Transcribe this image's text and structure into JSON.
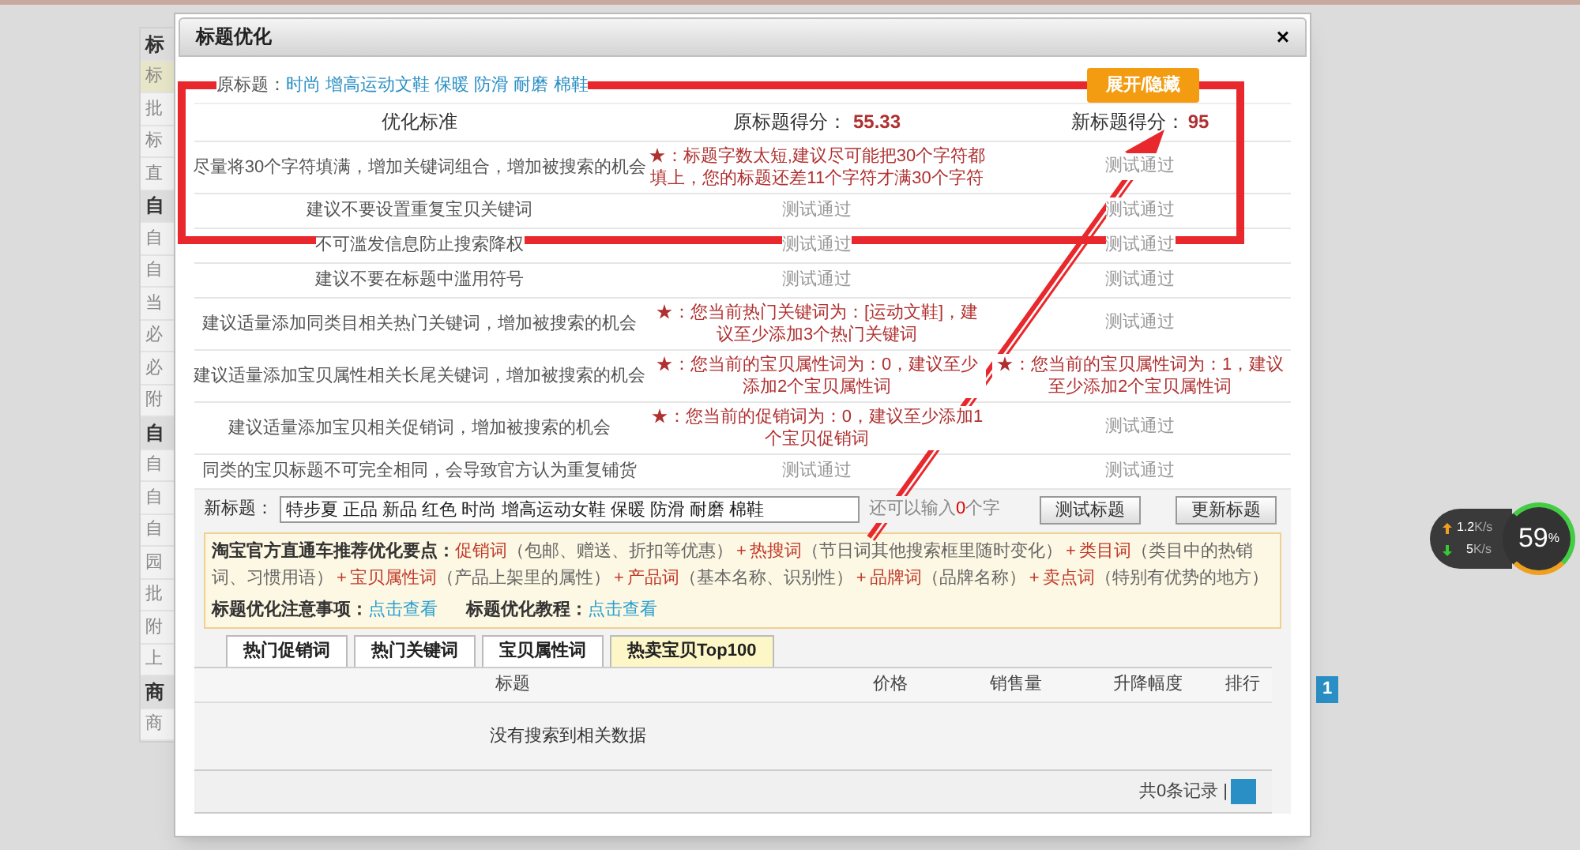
{
  "background_sidebar": {
    "items": [
      {
        "text": "标",
        "kind": "header"
      },
      {
        "text": "标",
        "kind": "item",
        "selected": true
      },
      {
        "text": "批",
        "kind": "item",
        "selected": false
      },
      {
        "text": "标",
        "kind": "item",
        "selected": false
      },
      {
        "text": "直",
        "kind": "item",
        "selected": false
      },
      {
        "text": "自",
        "kind": "header"
      },
      {
        "text": "自",
        "kind": "item",
        "selected": false
      },
      {
        "text": "自",
        "kind": "item",
        "selected": false
      },
      {
        "text": "当",
        "kind": "item",
        "selected": false
      },
      {
        "text": "必",
        "kind": "item",
        "selected": false
      },
      {
        "text": "必",
        "kind": "item",
        "selected": false
      },
      {
        "text": "附",
        "kind": "item",
        "selected": false
      },
      {
        "text": "自",
        "kind": "header"
      },
      {
        "text": "自",
        "kind": "item",
        "selected": false
      },
      {
        "text": "自",
        "kind": "item",
        "selected": false
      },
      {
        "text": "自",
        "kind": "item",
        "selected": false
      },
      {
        "text": "园",
        "kind": "item",
        "selected": false
      },
      {
        "text": "批",
        "kind": "item",
        "selected": false
      },
      {
        "text": "附",
        "kind": "item",
        "selected": false
      },
      {
        "text": "上",
        "kind": "item",
        "selected": false
      },
      {
        "text": "商",
        "kind": "header"
      },
      {
        "text": "商",
        "kind": "item",
        "selected": false
      }
    ]
  },
  "background_pager": {
    "page": "1"
  },
  "network_widget": {
    "upload": "1.2",
    "upload_unit": "K/s",
    "download": "5",
    "download_unit": "K/s",
    "percent": "59",
    "percent_sign": "%"
  },
  "dialog": {
    "title": "标题优化",
    "close": "×",
    "original_title": {
      "label": "原标题：",
      "value": "时尚 增高运动文鞋 保暖 防滑 耐磨 棉鞋"
    },
    "toggle_button": "展开/隐藏",
    "header": {
      "standard": "优化标准",
      "original_label": "原标题得分：",
      "original_score": "55.33",
      "new_label": "新标题得分：",
      "new_score": "95"
    },
    "rows": [
      {
        "standard": "尽量将30个字符填满，增加关键词组合，增加被搜索的机会",
        "original": {
          "kind": "warn",
          "text": "★：标题字数太短,建议尽可能把30个字符都填上，您的标题还差11个字符才满30个字符"
        },
        "new": {
          "kind": "pass",
          "text": "测试通过"
        }
      },
      {
        "standard": "建议不要设置重复宝贝关键词",
        "original": {
          "kind": "pass",
          "text": "测试通过"
        },
        "new": {
          "kind": "pass",
          "text": "测试通过"
        }
      },
      {
        "standard": "不可滥发信息防止搜索降权",
        "original": {
          "kind": "pass",
          "text": "测试通过"
        },
        "new": {
          "kind": "pass",
          "text": "测试通过"
        }
      },
      {
        "standard": "建议不要在标题中滥用符号",
        "original": {
          "kind": "pass",
          "text": "测试通过"
        },
        "new": {
          "kind": "pass",
          "text": "测试通过"
        }
      },
      {
        "standard": "建议适量添加同类目相关热门关键词，增加被搜索的机会",
        "original": {
          "kind": "warn",
          "text": "★：您当前热门关键词为：[运动文鞋]，建议至少添加3个热门关键词"
        },
        "new": {
          "kind": "pass",
          "text": "测试通过"
        }
      },
      {
        "standard": "建议适量添加宝贝属性相关长尾关键词，增加被搜索的机会",
        "original": {
          "kind": "warn",
          "text": "★：您当前的宝贝属性词为：0，建议至少添加2个宝贝属性词"
        },
        "new": {
          "kind": "warn",
          "text": "★：您当前的宝贝属性词为：1，建议至少添加2个宝贝属性词"
        }
      },
      {
        "standard": "建议适量添加宝贝相关促销词，增加被搜索的机会",
        "original": {
          "kind": "warn",
          "text": "★：您当前的促销词为：0，建议至少添加1个宝贝促销词"
        },
        "new": {
          "kind": "pass",
          "text": "测试通过"
        }
      },
      {
        "standard": "同类的宝贝标题不可完全相同，会导致官方认为重复铺货",
        "original": {
          "kind": "pass",
          "text": "测试通过"
        },
        "new": {
          "kind": "pass",
          "text": "测试通过"
        }
      }
    ],
    "new_title": {
      "label": "新标题：",
      "value": "特步夏 正品 新品 红色 时尚 增高运动女鞋 保暖 防滑 耐磨 棉鞋",
      "remain_before": "还可以输入",
      "remain_count": "0",
      "remain_after": "个字",
      "test_button": "测试标题",
      "update_button": "更新标题"
    },
    "tips": {
      "segments": [
        {
          "kind": "heading",
          "text": "淘宝官方直通车推荐优化要点："
        },
        {
          "kind": "term",
          "text": "促销词"
        },
        {
          "kind": "desc",
          "text": "（包邮、赠送、折扣等优惠）"
        },
        {
          "kind": "plus",
          "text": "+"
        },
        {
          "kind": "term",
          "text": "热搜词"
        },
        {
          "kind": "desc",
          "text": "（节日词其他搜索框里随时变化）"
        },
        {
          "kind": "plus",
          "text": "+"
        },
        {
          "kind": "term",
          "text": "类目词"
        },
        {
          "kind": "desc",
          "text": "（类目中的热销词、习惯用语）"
        },
        {
          "kind": "plus",
          "text": "+"
        },
        {
          "kind": "term",
          "text": "宝贝属性词"
        },
        {
          "kind": "desc",
          "text": "（产品上架里的属性）"
        },
        {
          "kind": "plus",
          "text": "+"
        },
        {
          "kind": "term",
          "text": "产品词"
        },
        {
          "kind": "desc",
          "text": "（基本名称、识别性）"
        },
        {
          "kind": "plus",
          "text": "+"
        },
        {
          "kind": "term",
          "text": "品牌词"
        },
        {
          "kind": "desc",
          "text": "（品牌名称）"
        },
        {
          "kind": "plus",
          "text": "+"
        },
        {
          "kind": "term",
          "text": "卖点词"
        },
        {
          "kind": "desc",
          "text": "（特别有优势的地方）"
        }
      ],
      "links": [
        {
          "label": "标题优化注意事项：",
          "link": "点击查看"
        },
        {
          "label": "标题优化教程：",
          "link": "点击查看"
        }
      ]
    },
    "tabs": [
      {
        "label": "热门促销词",
        "selected": false
      },
      {
        "label": "热门关键词",
        "selected": false
      },
      {
        "label": "宝贝属性词",
        "selected": false
      },
      {
        "label": "热卖宝贝Top100",
        "selected": true
      }
    ],
    "table": {
      "columns": [
        "标题",
        "价格",
        "销售量",
        "升降幅度",
        "排行"
      ],
      "empty": "没有搜索到相关数据",
      "footer": "共0条记录 |"
    }
  }
}
